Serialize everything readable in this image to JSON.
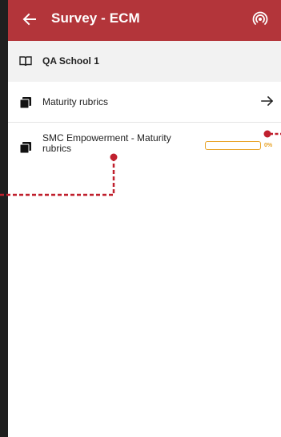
{
  "header": {
    "title": "Survey - ECM",
    "back_icon": "arrow-left-icon",
    "action_icon": "offline-broadcast-icon",
    "color": "#b3353a"
  },
  "school": {
    "name": "QA School 1",
    "icon": "book-open-icon"
  },
  "surveys": [
    {
      "label": "Maturity rubrics",
      "icon": "folder-icon",
      "action_icon": "arrow-right-icon"
    },
    {
      "label": "SMC Empowerment - Maturity rubrics",
      "icon": "folder-icon",
      "progress_value": 0,
      "progress_label": "0%",
      "progress_color": "#e8a327"
    }
  ],
  "annotation": {
    "color": "#c0202e"
  }
}
